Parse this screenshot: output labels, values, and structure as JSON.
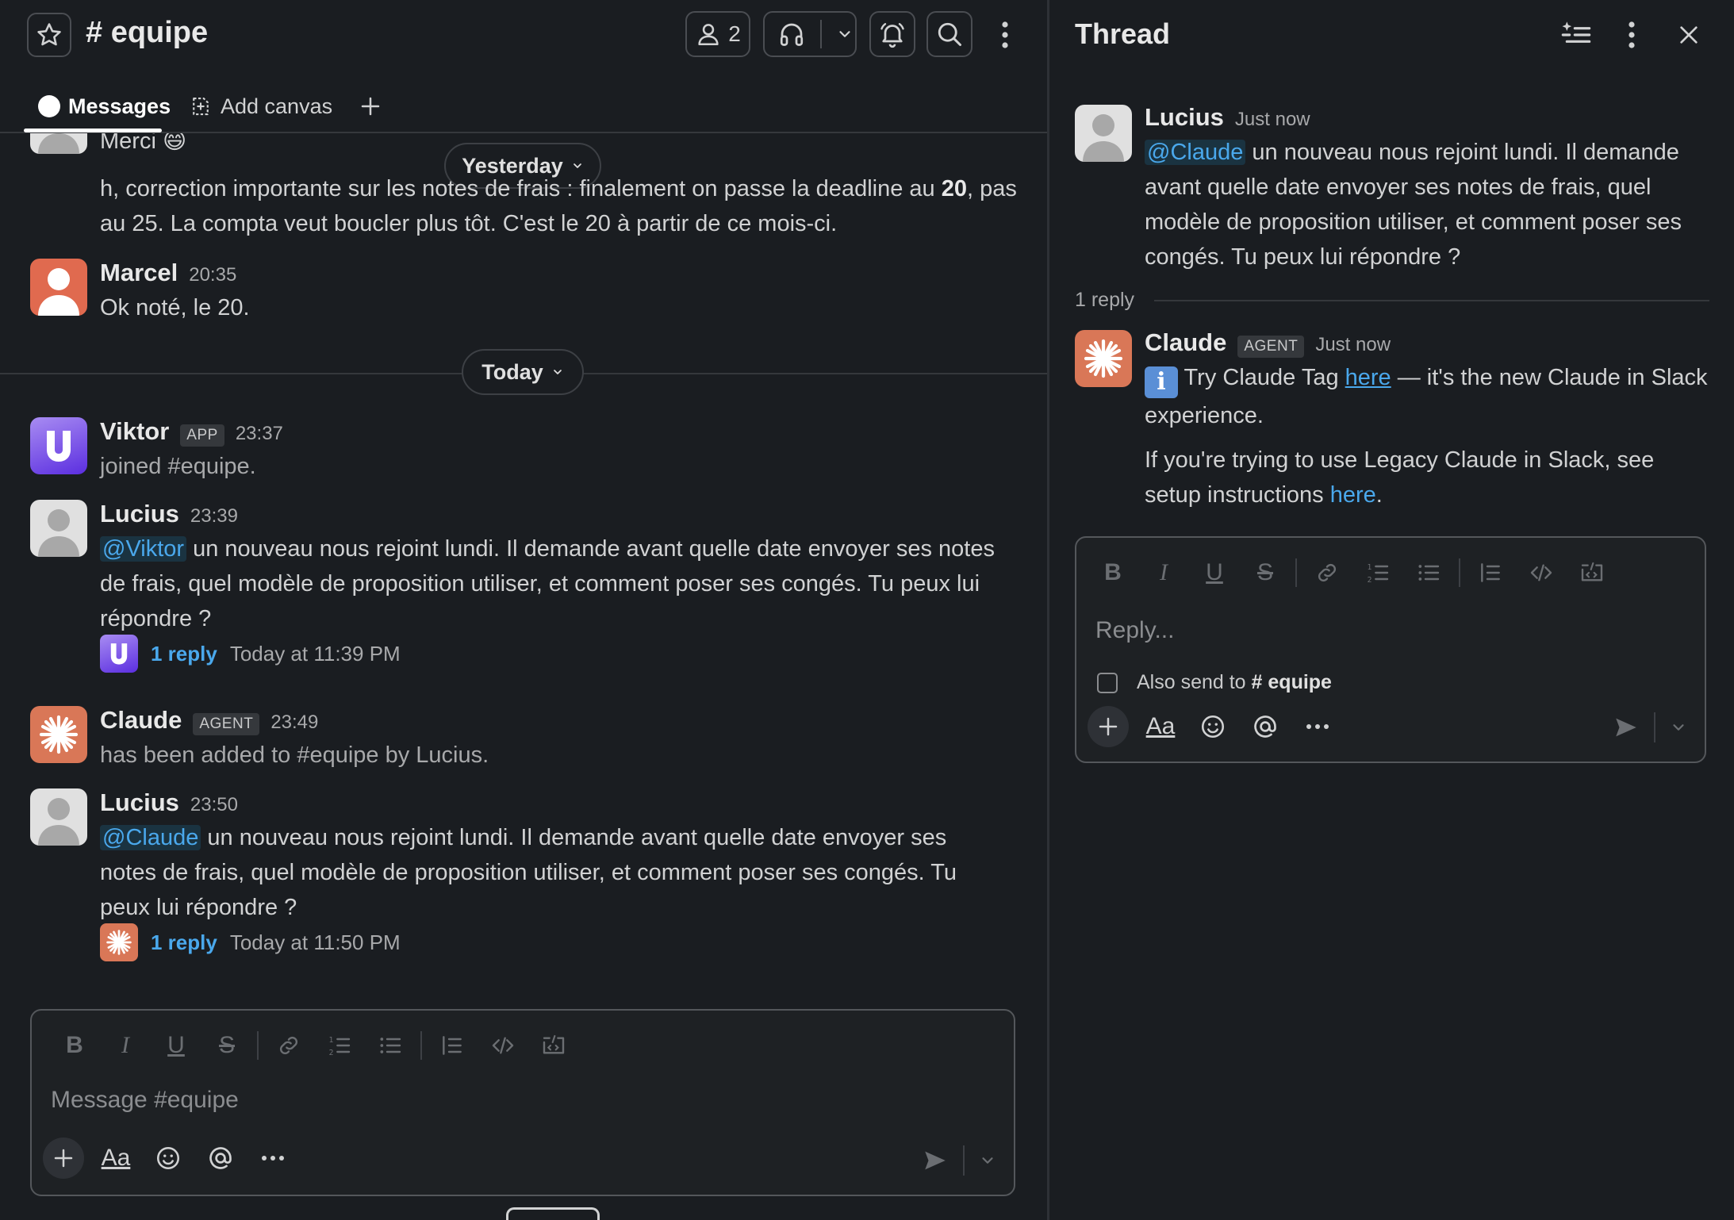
{
  "channel": {
    "name": "# equipe",
    "member_count": "2",
    "tabs": [
      {
        "label": "Messages"
      },
      {
        "label": "Add canvas"
      }
    ]
  },
  "messages": {
    "partial": {
      "text": "Merci 😄"
    },
    "correction": {
      "pre": "h, correction importante sur les notes de frais : finalement on passe la deadline au ",
      "bold": "20",
      "post": ", pas au 25. La compta veut boucler plus tôt. C'est le 20 à partir de ce mois-ci."
    },
    "marcel": {
      "author": "Marcel",
      "time": "20:35",
      "text": "Ok noté, le 20."
    },
    "yesterday_label": "Yesterday",
    "today_label": "Today",
    "viktor": {
      "author": "Viktor",
      "badge": "APP",
      "time": "23:37",
      "text": "joined #equipe."
    },
    "lucius1": {
      "author": "Lucius",
      "time": "23:39",
      "mention": "@Viktor",
      "text": " un nouveau nous rejoint lundi. Il demande avant quelle date envoyer ses notes de frais, quel modèle de proposition utiliser, et comment poser ses congés. Tu peux lui répondre ?",
      "reply_link": "1 reply",
      "reply_time": "Today at 11:39 PM"
    },
    "claude_join": {
      "author": "Claude",
      "badge": "AGENT",
      "time": "23:49",
      "text": "has been added to #equipe by Lucius."
    },
    "lucius2": {
      "author": "Lucius",
      "time": "23:50",
      "mention": "@Claude",
      "text": " un nouveau nous rejoint lundi. Il demande avant quelle date envoyer ses notes de frais, quel modèle de proposition utiliser, et comment poser ses congés. Tu peux lui répondre ?",
      "reply_link": "1 reply",
      "reply_time": "Today at 11:50 PM"
    }
  },
  "composer": {
    "placeholder": "Message #equipe"
  },
  "thread": {
    "title": "Thread",
    "parent": {
      "author": "Lucius",
      "time": "Just now",
      "mention": "@Claude",
      "text": " un nouveau nous rejoint lundi. Il demande avant quelle date envoyer ses notes de frais, quel modèle de proposition utiliser, et comment poser ses congés. Tu peux lui répondre ?"
    },
    "reply_count": "1 reply",
    "reply": {
      "author": "Claude",
      "badge": "AGENT",
      "time": "Just now",
      "info_glyph": "i",
      "p1_pre": " Try Claude Tag ",
      "p1_link": "here",
      "p1_post": " — it's the new Claude in Slack experience.",
      "p2_pre": "If you're trying to use Legacy Claude in Slack, see setup instructions ",
      "p2_link": "here",
      "p2_post": "."
    },
    "composer": {
      "placeholder": "Reply...",
      "also_send_pre": "Also send to",
      "also_send_channel": "# equipe"
    }
  },
  "colors": {
    "background": "#1a1d21",
    "link": "#4aa8ec",
    "claude_orange": "#d97757",
    "viktor_purple": "#6f3ff0",
    "marcel_red": "#e06a4f"
  },
  "icons": {
    "header": [
      "star-icon",
      "person-icon",
      "headphones-icon",
      "chevron-down-icon",
      "bell-icon",
      "search-icon",
      "kebab-icon"
    ],
    "thread": [
      "sparkle-list-icon",
      "kebab-icon",
      "close-icon"
    ],
    "format": [
      "bold-icon",
      "italic-icon",
      "underline-icon",
      "strike-icon",
      "link-icon",
      "ordered-list-icon",
      "bullet-list-icon",
      "blockquote-icon",
      "code-icon",
      "code-block-icon"
    ],
    "composer": [
      "plus-icon",
      "text-format-icon",
      "emoji-icon",
      "mention-icon",
      "more-icon",
      "send-icon",
      "chevron-down-icon"
    ]
  }
}
